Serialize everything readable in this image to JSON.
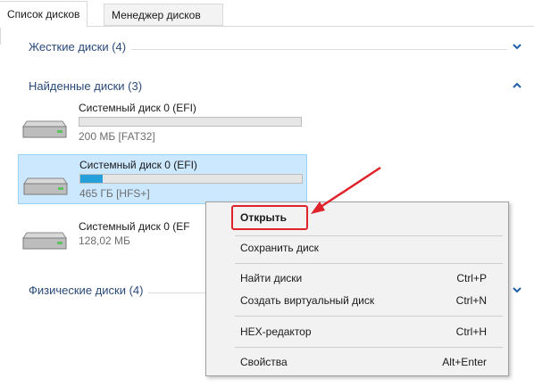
{
  "tabs": [
    {
      "label": "Список дисков",
      "active": true
    },
    {
      "label": "Менеджер дисков",
      "active": false
    }
  ],
  "groups": {
    "hard": {
      "title": "Жесткие диски (4)",
      "expanded": false
    },
    "found": {
      "title": "Найденные диски (3)",
      "expanded": true
    },
    "physical": {
      "title": "Физические диски (4)",
      "expanded": false
    }
  },
  "disks": [
    {
      "name": "Системный диск 0 (EFI)",
      "info": "200 МБ [FAT32]",
      "fill": 0,
      "selected": false
    },
    {
      "name": "Системный диск 0 (EFI)",
      "info": "465 ГБ [HFS+]",
      "fill": 0.1,
      "selected": true
    },
    {
      "name": "Системный диск 0 (EF",
      "info": "128,02 МБ",
      "fill": null,
      "selected": false
    }
  ],
  "context_menu": {
    "open": "Открыть",
    "save_disk": "Сохранить диск",
    "find_disks": {
      "label": "Найти диски",
      "shortcut": "Ctrl+P"
    },
    "create_virtual": {
      "label": "Создать виртуальный диск",
      "shortcut": "Ctrl+N"
    },
    "hex_editor": {
      "label": "HEX-редактор",
      "shortcut": "Ctrl+H"
    },
    "properties": {
      "label": "Свойства",
      "shortcut": "Alt+Enter"
    }
  },
  "colors": {
    "accent": "#26a0da",
    "selection": "#cce8ff",
    "highlight": "#e0232b",
    "group_title": "#2a4a7a"
  },
  "icons": {
    "disk": "hard-drive-icon",
    "collapse": "chevron-up-icon",
    "expand": "chevron-down-icon"
  }
}
